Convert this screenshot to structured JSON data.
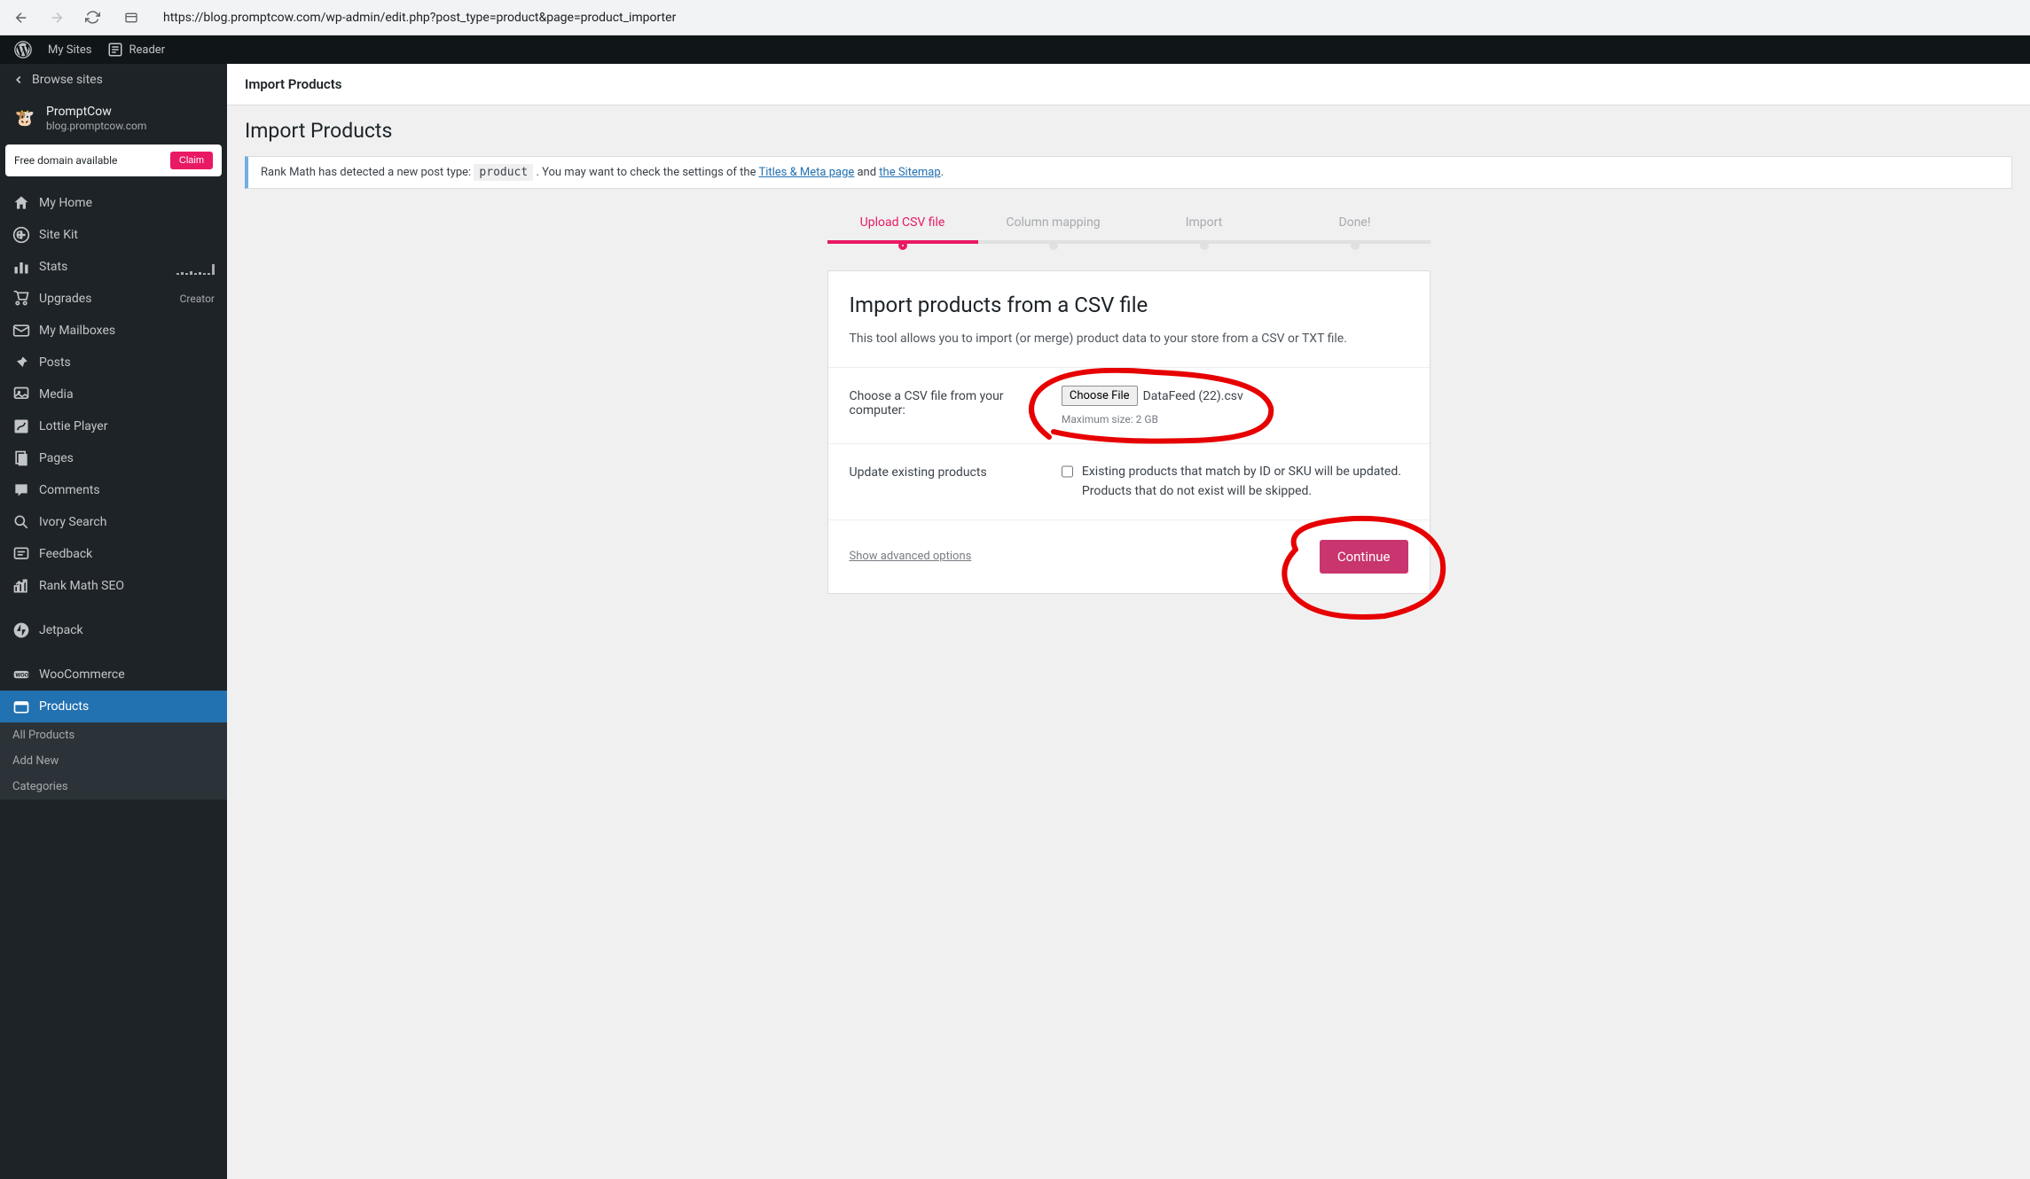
{
  "browser": {
    "url": "https://blog.promptcow.com/wp-admin/edit.php?post_type=product&page=product_importer"
  },
  "toolbar": {
    "my_sites": "My Sites",
    "reader": "Reader"
  },
  "sidebar": {
    "browse_sites": "Browse sites",
    "site_name": "PromptCow",
    "site_url": "blog.promptcow.com",
    "domain_upsell": "Free domain available",
    "claim_btn": "Claim",
    "items": [
      {
        "label": "My Home",
        "icon": "home"
      },
      {
        "label": "Site Kit",
        "icon": "google"
      },
      {
        "label": "Stats",
        "icon": "stats",
        "sparkline": true
      },
      {
        "label": "Upgrades",
        "icon": "cart",
        "badge": "Creator"
      },
      {
        "label": "My Mailboxes",
        "icon": "mail"
      },
      {
        "label": "Posts",
        "icon": "pin"
      },
      {
        "label": "Media",
        "icon": "media"
      },
      {
        "label": "Lottie Player",
        "icon": "lottie"
      },
      {
        "label": "Pages",
        "icon": "pages"
      },
      {
        "label": "Comments",
        "icon": "comment"
      },
      {
        "label": "Ivory Search",
        "icon": "search"
      },
      {
        "label": "Feedback",
        "icon": "feedback"
      },
      {
        "label": "Rank Math SEO",
        "icon": "rankmath"
      },
      {
        "label": "Jetpack",
        "icon": "jetpack",
        "gap": true
      },
      {
        "label": "WooCommerce",
        "icon": "woo",
        "gap": true
      },
      {
        "label": "Products",
        "icon": "products",
        "active": true
      }
    ],
    "submenu": [
      "All Products",
      "Add New",
      "Categories"
    ]
  },
  "header": {
    "title": "Import Products"
  },
  "page": {
    "title": "Import Products"
  },
  "notice": {
    "text_before": "Rank Math has detected a new post type: ",
    "code": "product",
    "text_mid": " . You may want to check the settings of the ",
    "link1": "Titles & Meta page",
    "text_and": " and ",
    "link2": "the Sitemap",
    "text_end": "."
  },
  "steps": [
    {
      "label": "Upload CSV file",
      "active": true
    },
    {
      "label": "Column mapping",
      "active": false
    },
    {
      "label": "Import",
      "active": false
    },
    {
      "label": "Done!",
      "active": false
    }
  ],
  "importer": {
    "title": "Import products from a CSV file",
    "description": "This tool allows you to import (or merge) product data to your store from a CSV or TXT file.",
    "choose_label": "Choose a CSV file from your computer:",
    "choose_btn": "Choose File",
    "file_name": "DataFeed (22).csv",
    "max_size": "Maximum size: 2 GB",
    "update_label": "Update existing products",
    "update_desc": "Existing products that match by ID or SKU will be updated. Products that do not exist will be skipped.",
    "advanced": "Show advanced options",
    "continue": "Continue"
  }
}
